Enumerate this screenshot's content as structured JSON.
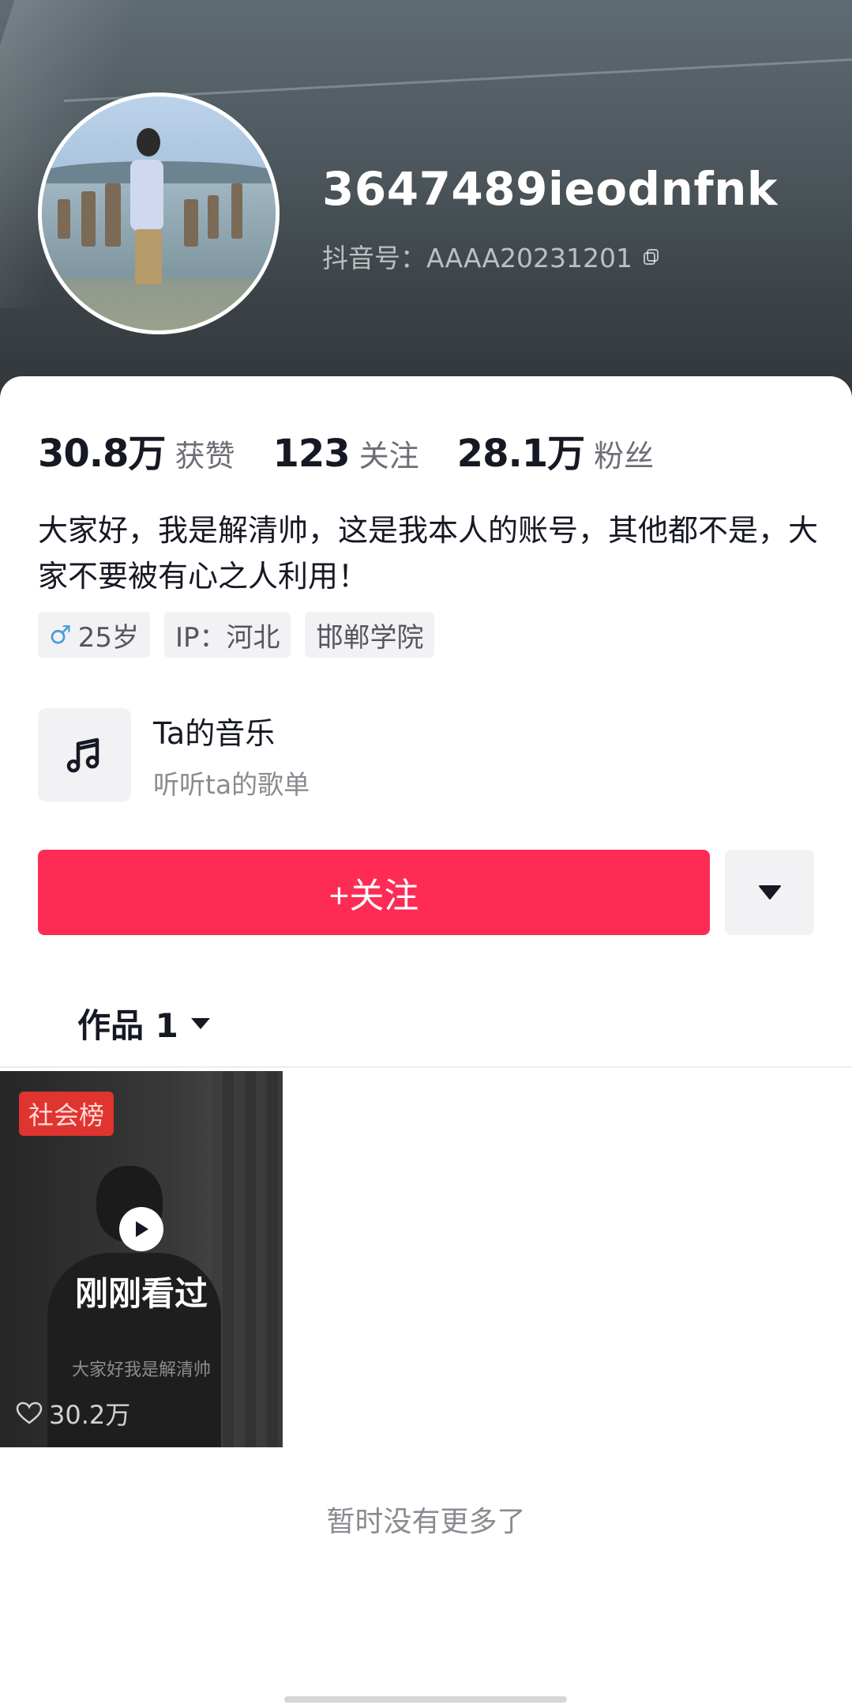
{
  "profile": {
    "username": "3647489ieodnfnk",
    "douyin_id": "抖音号：AAAA20231201",
    "avatar_icon": "avatar-photo"
  },
  "stats": [
    {
      "value": "30.8万",
      "label": "获赞"
    },
    {
      "value": "123",
      "label": "关注"
    },
    {
      "value": "28.1万",
      "label": "粉丝"
    }
  ],
  "bio": "大家好，我是解清帅，这是我本人的账号，其他都不是，大家不要被有心之人利用！",
  "tags": {
    "age": "25岁",
    "ip": "IP：河北",
    "school": "邯郸学院"
  },
  "music": {
    "title": "Ta的音乐",
    "subtitle": "听听ta的歌单"
  },
  "actions": {
    "follow_label": "+关注",
    "more_icon": "triangle-down-icon"
  },
  "works_tab": {
    "label": "作品 1"
  },
  "video": {
    "badge": "社会榜",
    "watched_label": "刚刚看过",
    "caption": "大家好我是解清帅",
    "likes": "30.2万"
  },
  "footer": {
    "no_more": "暂时没有更多了"
  },
  "colors": {
    "accent": "#fe2c55",
    "badge": "#e0342f"
  }
}
